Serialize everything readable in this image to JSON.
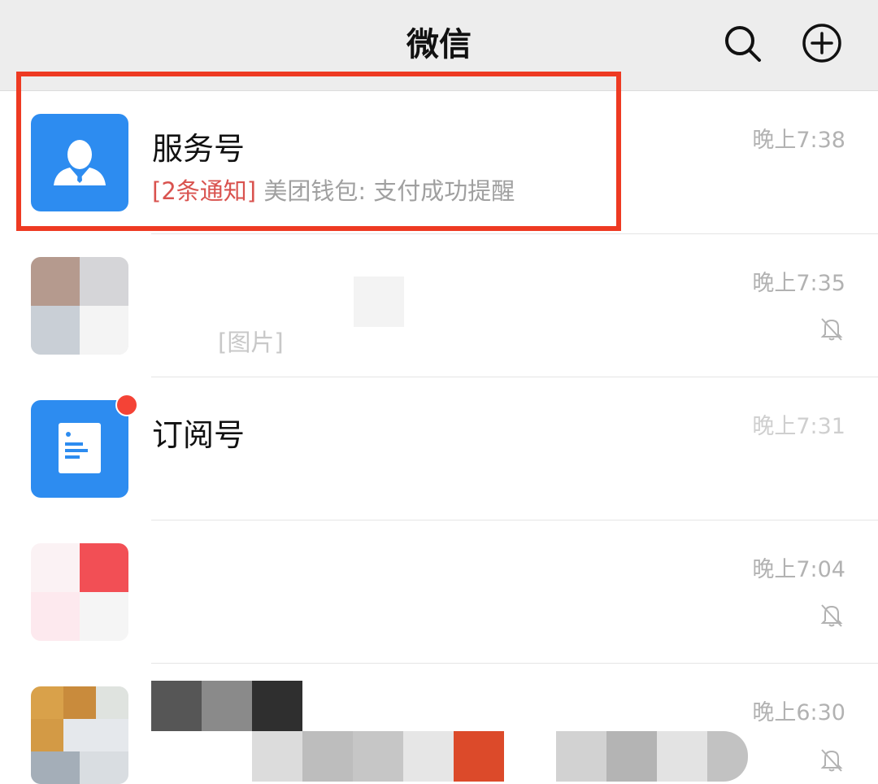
{
  "header": {
    "title": "微信",
    "search_icon": "search-icon",
    "add_icon": "plus-circle-icon"
  },
  "chats": [
    {
      "name": "服务号",
      "notice": "[2条通知]",
      "message": "美团钱包: 支付成功提醒",
      "time": "晚上7:38",
      "muted": false
    },
    {
      "name": "",
      "message": "[图片]",
      "time": "晚上7:35",
      "muted": true
    },
    {
      "name": "订阅号",
      "message": "",
      "time": "晚上7:31",
      "muted": false,
      "unread_dot": true
    },
    {
      "name": "",
      "message": "",
      "time": "晚上7:04",
      "muted": true
    },
    {
      "name": "",
      "message": "",
      "time": "晚上6:30",
      "muted": true
    }
  ],
  "colors": {
    "accent_red": "#ee3a22",
    "avatar_blue": "#2d8cf0",
    "notice_red": "#d9534f"
  }
}
